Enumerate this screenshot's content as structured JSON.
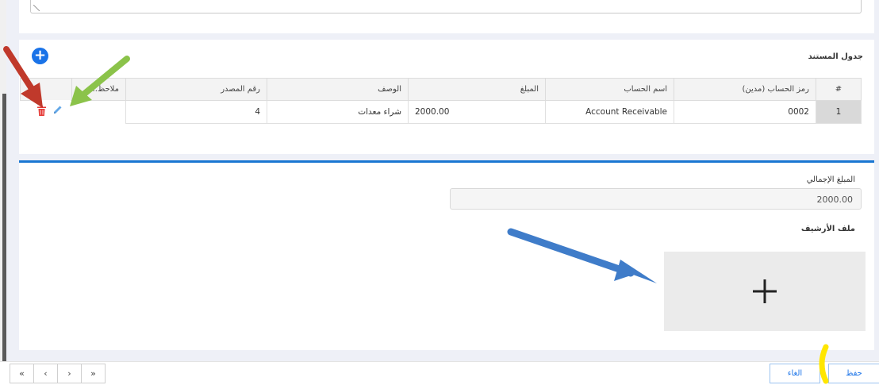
{
  "document_table": {
    "title": "جدول المستند",
    "headers": {
      "index": "#",
      "account_code": "رمز الحساب (مدين)",
      "account_name": "اسم الحساب",
      "amount": "المبلغ",
      "description": "الوصف",
      "reference_no": "رقم المصدر",
      "notes": "ملاحظ..."
    },
    "rows": [
      {
        "index": "1",
        "account_code": "0002",
        "account_name": "Account Receivable",
        "amount": "2000.00",
        "description": "شراء معدات",
        "reference_no": "4",
        "notes": ""
      }
    ]
  },
  "summary": {
    "total_label": "المبلغ الإجمالي",
    "total_value": "2000.00",
    "archive_label": "ملف الأرشيف"
  },
  "footer": {
    "save_label": "حفظ",
    "cancel_label": "الغاء",
    "pager": [
      "«",
      "‹",
      "›",
      "»"
    ]
  },
  "colors": {
    "accent": "#1a73e8",
    "divider": "#1976d2",
    "delete": "#e53935",
    "annotation_red": "#c0392b",
    "annotation_green": "#8bc34a",
    "annotation_blue": "#3f7cc9",
    "annotation_yellow": "#ffe600"
  }
}
